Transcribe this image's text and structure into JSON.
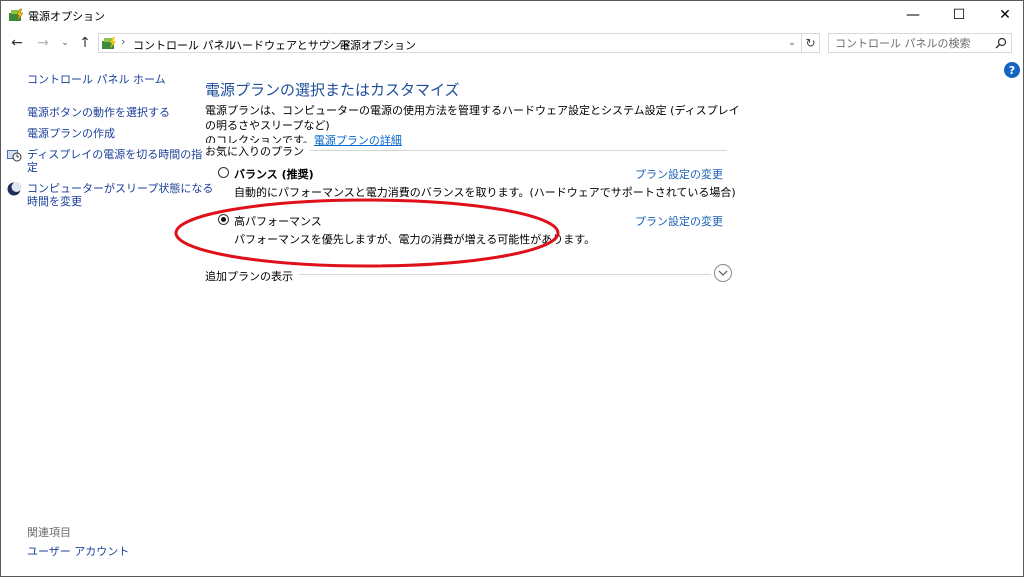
{
  "window": {
    "title": "電源オプション",
    "controls": {
      "minimize": "—",
      "maximize": "☐",
      "close": "✕"
    }
  },
  "nav": {
    "back": "←",
    "forward": "→",
    "recent": "⌄",
    "up": "↑"
  },
  "address": {
    "breadcrumbs": [
      "コントロール パネル",
      "ハードウェアとサウンド",
      "電源オプション"
    ],
    "separator": "›",
    "dropdown": "⌄",
    "refresh": "↻"
  },
  "search": {
    "placeholder": "コントロール パネルの検索"
  },
  "help": {
    "label": "?"
  },
  "sidebar": {
    "home": "コントロール パネル ホーム",
    "items": [
      {
        "label": "電源ボタンの動作を選択する"
      },
      {
        "label": "電源プランの作成"
      },
      {
        "label": "ディスプレイの電源を切る時間の指定",
        "line1": "ディスプレイの電源を切る時間の指",
        "line2": "定",
        "icon": "clock-display-icon"
      },
      {
        "label": "コンピューターがスリープ状態になる時間を変更",
        "line1": "コンピューターがスリープ状態になる",
        "line2": "時間を変更",
        "icon": "moon-icon"
      }
    ],
    "related_header": "関連項目",
    "related": [
      {
        "label": "ユーザー アカウント"
      }
    ]
  },
  "main": {
    "title": "電源プランの選択またはカスタマイズ",
    "description_line1": "電源プランは、コンピューターの電源の使用方法を管理するハードウェア設定とシステム設定 (ディスプレイの明るさやスリープなど)",
    "description_line2": "のコレクションです。",
    "details_link": "電源プランの詳細",
    "favorites_label": "お気に入りのプラン",
    "plans": [
      {
        "name": "バランス (推奨)",
        "description": "自動的にパフォーマンスと電力消費のバランスを取ります。(ハードウェアでサポートされている場合)",
        "selected": false,
        "link": "プラン設定の変更"
      },
      {
        "name": "高パフォーマンス",
        "description": "パフォーマンスを優先しますが、電力の消費が増える可能性があります。",
        "selected": true,
        "link": "プラン設定の変更"
      }
    ],
    "additional_plans_label": "追加プランの表示"
  },
  "colors": {
    "link": "#1a3f9a",
    "title": "#1e4e9a",
    "annotation": "#e0101a",
    "help": "#1565c0"
  }
}
